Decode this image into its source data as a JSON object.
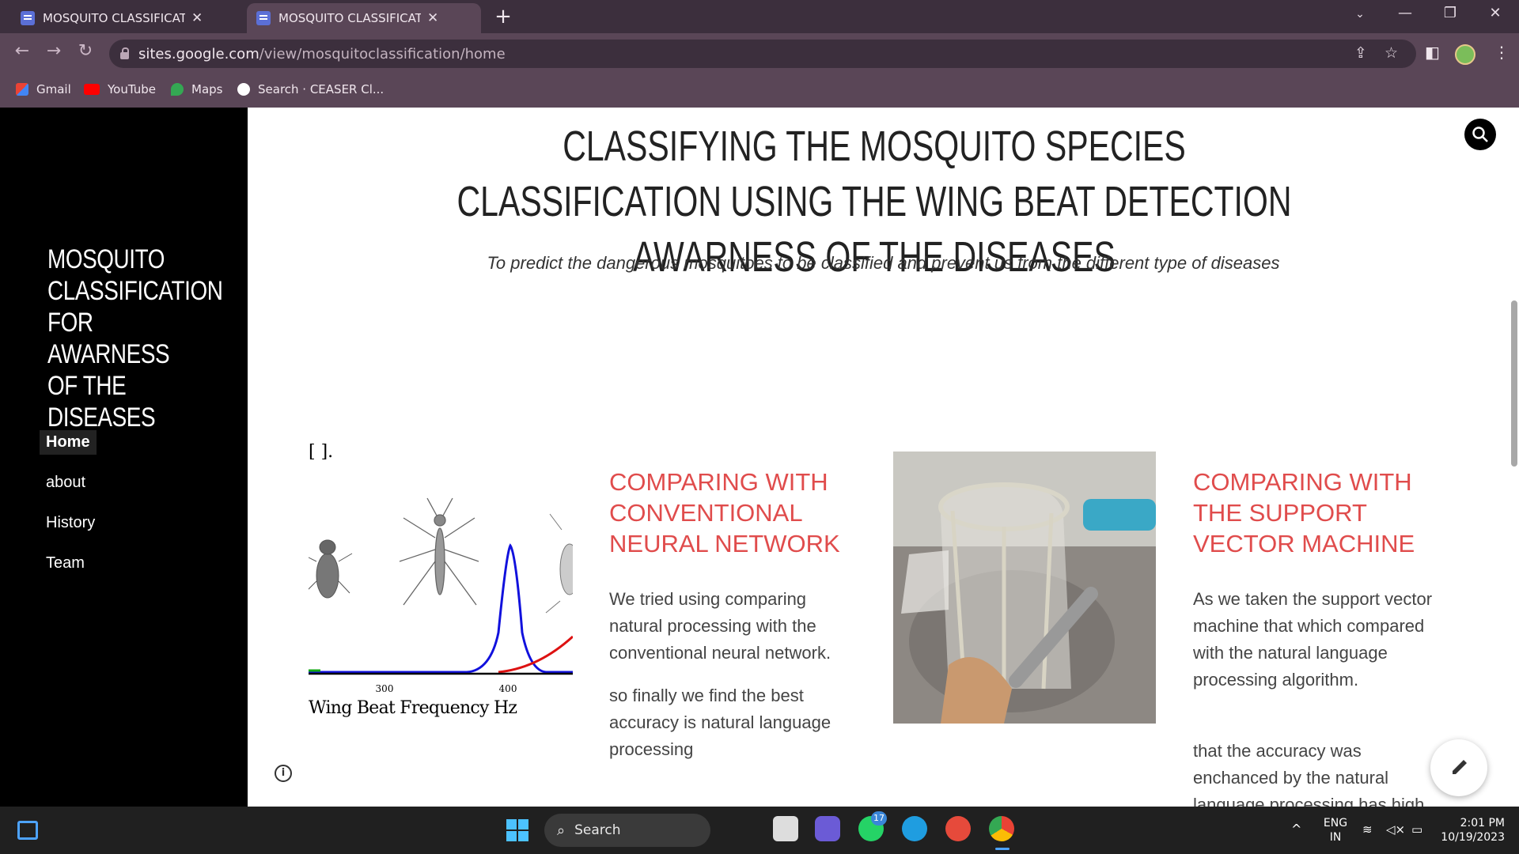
{
  "browser": {
    "tabs": [
      {
        "title": "MOSQUITO CLASSIFICATION FO",
        "active": false
      },
      {
        "title": "MOSQUITO CLASSIFICATION FO",
        "active": true
      }
    ],
    "url_host": "sites.google.com",
    "url_path": "/view/mosquitoclassification/home",
    "bookmarks": [
      "Gmail",
      "YouTube",
      "Maps",
      "Search · CEASER Cl..."
    ]
  },
  "site": {
    "title": "MOSQUITO\nCLASSIFICATION\nFOR AWARNESS\nOF THE DISEASES",
    "nav": [
      "Home",
      "about",
      "History",
      "Team"
    ],
    "active_nav": "Home"
  },
  "hero": {
    "title": "CLASSIFYING THE MOSQUITO SPECIES CLASSIFICATION USING THE WING BEAT DETECTION AWARNESS OF THE DISEASES",
    "subtitle": "To predict the dangerous mosquitoes to be classified and prevent us from the different type of diseases"
  },
  "figure1": {
    "caption": "Wing Beat Frequency Hz",
    "tick_300": "300",
    "tick_400": "400",
    "top_fragment": "[ ].",
    "colors": {
      "blue": "#1111dd",
      "red": "#dd1111",
      "green": "#11aa11"
    }
  },
  "section1": {
    "heading": "COMPARING WITH CONVENTIONAL NEURAL NETWORK",
    "para1": "We tried using comparing natural processing with the conventional neural network.",
    "para2": "so finally we find the best accuracy is natural language processing"
  },
  "section2": {
    "heading": "COMPARING WITH THE SUPPORT VECTOR MACHINE",
    "para1": "As we taken the support vector machine that which compared with the natural language processing algorithm.",
    "para2": "that the accuracy was enchanced by the natural language processing has high"
  },
  "taskbar": {
    "search_label": "Search",
    "whatsapp_badge": "17",
    "lang": "ENG",
    "region": "IN",
    "time": "2:01 PM",
    "date": "10/19/2023"
  },
  "colors": {
    "accent_red": "#e04c4c",
    "sidebar_bg": "#000000",
    "chrome_dark": "#3c2f3d",
    "chrome_mid": "#5a4657"
  }
}
